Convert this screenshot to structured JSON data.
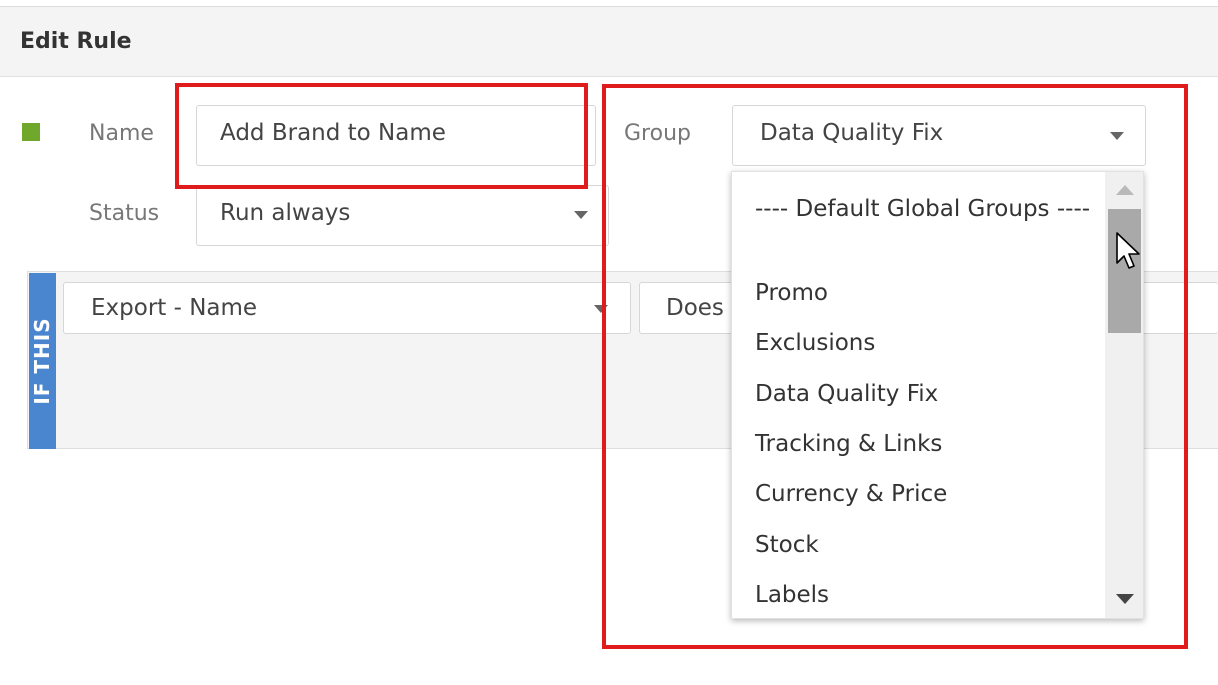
{
  "header": {
    "title": "Edit Rule"
  },
  "form": {
    "name_label": "Name",
    "name_value": "Add Brand to Name",
    "status_label": "Status",
    "status_value": "Run always",
    "group_label": "Group",
    "group_value": "Data Quality Fix"
  },
  "condition": {
    "section_label": "IF THIS",
    "field_value": "Export - Name",
    "operator_value": "Does"
  },
  "group_dropdown": {
    "options": [
      "---- Default Global Groups ----",
      "Promo",
      "Exclusions",
      "Data Quality Fix",
      "Tracking & Links",
      "Currency & Price",
      "Stock",
      "Labels"
    ]
  },
  "colors": {
    "rule_color": "#6fa82b",
    "ifthis_bar": "#4a86cf",
    "highlight": "#e01b1b"
  }
}
